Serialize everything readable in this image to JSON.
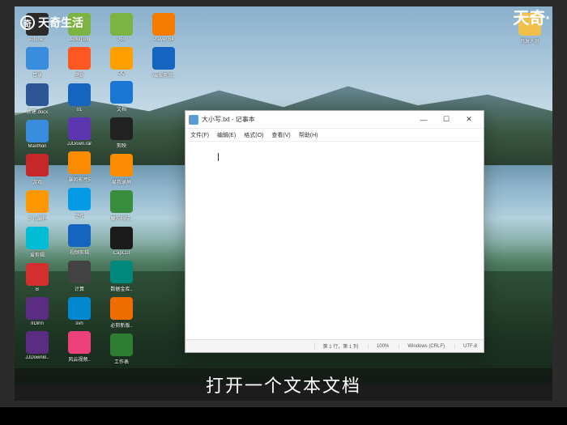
{
  "watermark": {
    "left_text": "天奇生活",
    "right_text": "天奇·"
  },
  "subtitle": "打开一个文本文档",
  "notepad": {
    "title": "大小写.txt - 记事本",
    "menus": [
      "文件(F)",
      "编辑(E)",
      "格式(O)",
      "查看(V)",
      "帮助(H)"
    ],
    "status": {
      "position": "第 1 行，第 1 列",
      "zoom": "100%",
      "eol": "Windows (CRLF)",
      "encoding": "UTF-8"
    },
    "controls": {
      "minimize": "—",
      "maximize": "☐",
      "close": "✕"
    }
  },
  "desktop_icons_right": [
    {
      "label": "开发人员",
      "color": "#f0c04a"
    }
  ],
  "desktop_icons": [
    {
      "label": "Adobe..",
      "color": "#2a2a2a"
    },
    {
      "label": "目录",
      "color": "#3a8dde"
    },
    {
      "label": "新建.docx",
      "color": "#2b5797"
    },
    {
      "label": "Maxthon",
      "color": "#3a8dde"
    },
    {
      "label": "游戏",
      "color": "#c62828"
    },
    {
      "label": "少儿编程",
      "color": "#ff9800"
    },
    {
      "label": "爱剪辑",
      "color": "#00bcd4"
    },
    {
      "label": "B",
      "color": "#d32f2f"
    },
    {
      "label": "IIDinn",
      "color": "#5a2d82"
    },
    {
      "label": "JJDownlo..",
      "color": "#5a2d82"
    },
    {
      "label": "debug.log",
      "color": "#7cb342"
    },
    {
      "label": "壁纸",
      "color": "#ff5722"
    },
    {
      "label": "01",
      "color": "#1565c0"
    },
    {
      "label": "JJDown.rar",
      "color": "#5e35b1"
    },
    {
      "label": "暴风影音5",
      "color": "#fb8c00"
    },
    {
      "label": "动作",
      "color": "#039be5"
    },
    {
      "label": "视频剪辑",
      "color": "#1565c0"
    },
    {
      "label": "计算",
      "color": "#424242"
    },
    {
      "label": "svn",
      "color": "#0288d1"
    },
    {
      "label": "风云视频..",
      "color": "#ec407a"
    },
    {
      "label": "360",
      "color": "#7cb342"
    },
    {
      "label": "QQ",
      "color": "#ffa000"
    },
    {
      "label": "文档",
      "color": "#1976d2"
    },
    {
      "label": "剪映",
      "color": "#212121"
    },
    {
      "label": "易我录屏",
      "color": "#fb8c00"
    },
    {
      "label": "魔方科技..",
      "color": "#388e3c"
    },
    {
      "label": "CapCut",
      "color": "#1a1a1a"
    },
    {
      "label": "数据金库..",
      "color": "#00897b"
    },
    {
      "label": "必剪新版..",
      "color": "#ef6c00"
    },
    {
      "label": "工作表",
      "color": "#2e7d32"
    },
    {
      "label": "Player 64",
      "color": "#f57c00"
    },
    {
      "label": "we业务员..",
      "color": "#1565c0"
    }
  ]
}
